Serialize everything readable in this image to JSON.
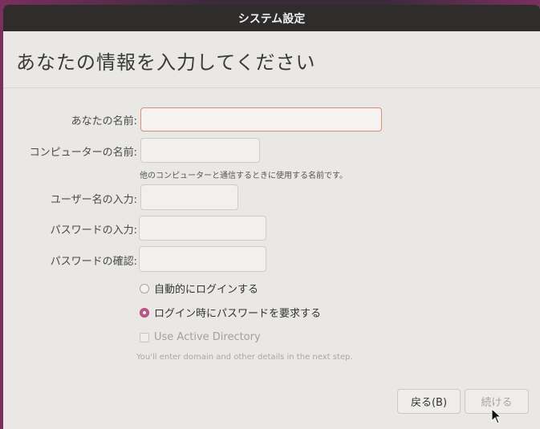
{
  "window": {
    "title": "システム設定"
  },
  "page": {
    "heading": "あなたの情報を入力してください"
  },
  "form": {
    "name_label": "あなたの名前:",
    "name_value": "",
    "computer_label": "コンピューターの名前:",
    "computer_value": "",
    "computer_hint": "他のコンピューターと通信するときに使用する名前です。",
    "username_label": "ユーザー名の入力:",
    "username_value": "",
    "password_label": "パスワードの入力:",
    "password_value": "",
    "confirm_label": "パスワードの確認:",
    "confirm_value": ""
  },
  "login_options": {
    "auto_login": "自動的にログインする",
    "require_password": "ログイン時にパスワードを要求する",
    "selected": "require_password"
  },
  "active_directory": {
    "label": "Use Active Directory",
    "note": "You'll enter domain and other details in the next step."
  },
  "buttons": {
    "back": "戻る(B)",
    "next": "続ける"
  },
  "colors": {
    "accent": "#c4538a",
    "focus_border": "#e38c72",
    "titlebar": "#2f2c2c"
  }
}
